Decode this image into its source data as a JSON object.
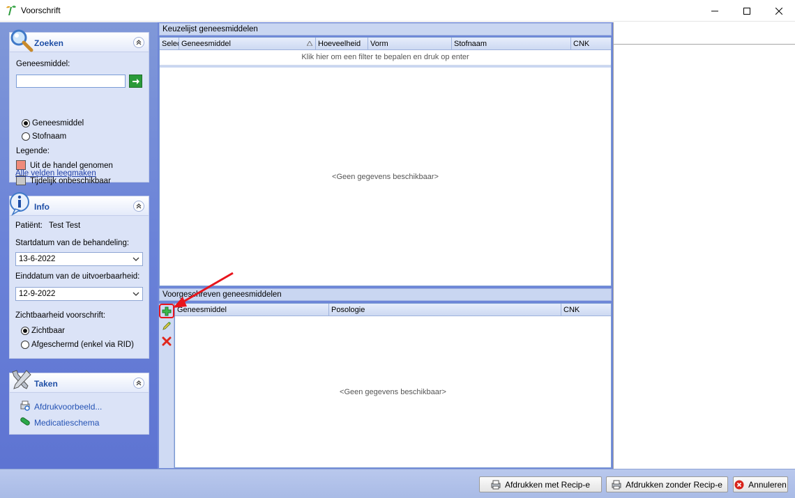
{
  "window": {
    "title": "Voorschrift"
  },
  "search": {
    "header": "Zoeken",
    "field_label": "Geneesmiddel:",
    "input_value": "",
    "radio_geneesmiddel": "Geneesmiddel",
    "radio_stofnaam": "Stofnaam",
    "legend_label": "Legende:",
    "legend_items": [
      {
        "label": "Uit de handel genomen",
        "color": "#f08a7a"
      },
      {
        "label": "Tijdelijk onbeschikbaar",
        "color": "#c8c8c8"
      }
    ],
    "clear_link": "Alle velden leegmaken"
  },
  "info": {
    "header": "Info",
    "patient_label": "Patiënt:",
    "patient_name": "Test Test",
    "start_label": "Startdatum van de behandeling:",
    "start_value": "13-6-2022",
    "end_label": "Einddatum van de uitvoerbaarheid:",
    "end_value": "12-9-2022",
    "visibility_label": "Zichtbaarheid voorschrift:",
    "visibility_visible": "Zichtbaar",
    "visibility_shielded": "Afgeschermd (enkel via RID)"
  },
  "tasks": {
    "header": "Taken",
    "print_preview": "Afdrukvoorbeeld...",
    "medication_schedule": "Medicatieschema"
  },
  "choice_list": {
    "title": "Keuzelijst geneesmiddelen",
    "columns": [
      "Selec",
      "Geneesmiddel",
      "Hoeveelheid",
      "Vorm",
      "Stofnaam",
      "CNK"
    ],
    "filter_hint": "Klik hier om een filter te bepalen en druk op enter",
    "empty": "<Geen gegevens beschikbaar>"
  },
  "prescribed": {
    "title": "Voorgeschreven geneesmiddelen",
    "columns": [
      "Geneesmiddel",
      "Posologie",
      "CNK"
    ],
    "empty": "<Geen gegevens beschikbaar>"
  },
  "footer": {
    "print_with": "Afdrukken met Recip-e",
    "print_without": "Afdrukken zonder Recip-e",
    "cancel": "Annuleren"
  },
  "colors": {
    "accent": "#1f4fa6",
    "panel": "#dbe3f7",
    "annotation": "#e8141c"
  }
}
